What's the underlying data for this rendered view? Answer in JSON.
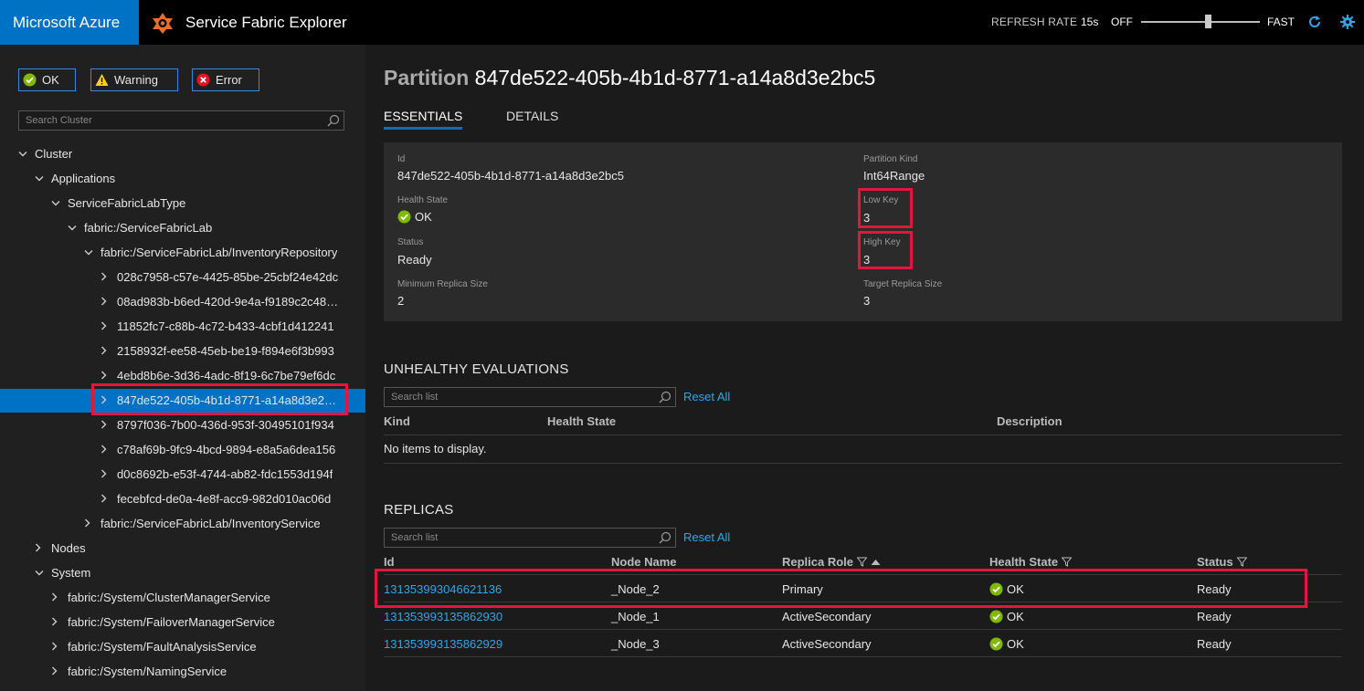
{
  "header": {
    "brand": "Microsoft Azure",
    "app_title": "Service Fabric Explorer",
    "refresh_rate_label": "REFRESH RATE",
    "refresh_rate_value": "15s",
    "refresh_off": "OFF",
    "refresh_fast": "FAST",
    "refresh_slider_level": 0.56
  },
  "sidebar": {
    "filters": {
      "ok": "OK",
      "warning": "Warning",
      "error": "Error"
    },
    "search_placeholder": "Search Cluster",
    "tree": [
      {
        "label": "Cluster",
        "expanded": true
      },
      {
        "label": "Applications",
        "expanded": true
      },
      {
        "label": "ServiceFabricLabType",
        "expanded": true
      },
      {
        "label": "fabric:/ServiceFabricLab",
        "expanded": true
      },
      {
        "label": "fabric:/ServiceFabricLab/InventoryRepository",
        "expanded": true
      },
      {
        "label": "028c7958-c57e-4425-85be-25cbf24e42dc",
        "expanded": false
      },
      {
        "label": "08ad983b-b6ed-420d-9e4a-f9189c2c48…",
        "expanded": false
      },
      {
        "label": "11852fc7-c88b-4c72-b433-4cbf1d412241",
        "expanded": false
      },
      {
        "label": "2158932f-ee58-45eb-be19-f894e6f3b993",
        "expanded": false
      },
      {
        "label": "4ebd8b6e-3d36-4adc-8f19-6c7be79ef6dc",
        "expanded": false
      },
      {
        "label": "847de522-405b-4b1d-8771-a14a8d3e2…",
        "expanded": false,
        "selected": true
      },
      {
        "label": "8797f036-7b00-436d-953f-30495101f934",
        "expanded": false
      },
      {
        "label": "c78af69b-9fc9-4bcd-9894-e8a5a6dea156",
        "expanded": false
      },
      {
        "label": "d0c8692b-e53f-4744-ab82-fdc1553d194f",
        "expanded": false
      },
      {
        "label": "fecebfcd-de0a-4e8f-acc9-982d010ac06d",
        "expanded": false
      },
      {
        "label": "fabric:/ServiceFabricLab/InventoryService",
        "expanded": false
      },
      {
        "label": "Nodes",
        "expanded": false
      },
      {
        "label": "System",
        "expanded": true
      },
      {
        "label": "fabric:/System/ClusterManagerService",
        "expanded": false
      },
      {
        "label": "fabric:/System/FailoverManagerService",
        "expanded": false
      },
      {
        "label": "fabric:/System/FaultAnalysisService",
        "expanded": false
      },
      {
        "label": "fabric:/System/NamingService",
        "expanded": false
      }
    ]
  },
  "main": {
    "title_kind": "Partition",
    "title_id": "847de522-405b-4b1d-8771-a14a8d3e2bc5",
    "tabs": {
      "essentials": "ESSENTIALS",
      "details": "DETAILS"
    },
    "essentials": {
      "id_label": "Id",
      "id_value": "847de522-405b-4b1d-8771-a14a8d3e2bc5",
      "health_label": "Health State",
      "health_value": "OK",
      "status_label": "Status",
      "status_value": "Ready",
      "min_replica_label": "Minimum Replica Size",
      "min_replica_value": "2",
      "partition_kind_label": "Partition Kind",
      "partition_kind_value": "Int64Range",
      "low_key_label": "Low Key",
      "low_key_value": "3",
      "high_key_label": "High Key",
      "high_key_value": "3",
      "target_replica_label": "Target Replica Size",
      "target_replica_value": "3"
    },
    "unhealthy": {
      "title": "UNHEALTHY EVALUATIONS",
      "search_placeholder": "Search list",
      "reset": "Reset All",
      "columns": {
        "kind": "Kind",
        "health": "Health State",
        "description": "Description"
      },
      "empty": "No items to display."
    },
    "replicas": {
      "title": "REPLICAS",
      "search_placeholder": "Search list",
      "reset": "Reset All",
      "columns": {
        "id": "Id",
        "node": "Node Name",
        "role": "Replica Role",
        "health": "Health State",
        "status": "Status"
      },
      "rows": [
        {
          "id": "131353993046621136",
          "node": "_Node_2",
          "role": "Primary",
          "health": "OK",
          "status": "Ready"
        },
        {
          "id": "131353993135862930",
          "node": "_Node_1",
          "role": "ActiveSecondary",
          "health": "OK",
          "status": "Ready"
        },
        {
          "id": "131353993135862929",
          "node": "_Node_3",
          "role": "ActiveSecondary",
          "health": "OK",
          "status": "Ready"
        }
      ]
    }
  },
  "colors": {
    "accent": "#0072c6",
    "link": "#2fa7e8",
    "highlight": "#e3173e",
    "ok": "#7fba00"
  }
}
